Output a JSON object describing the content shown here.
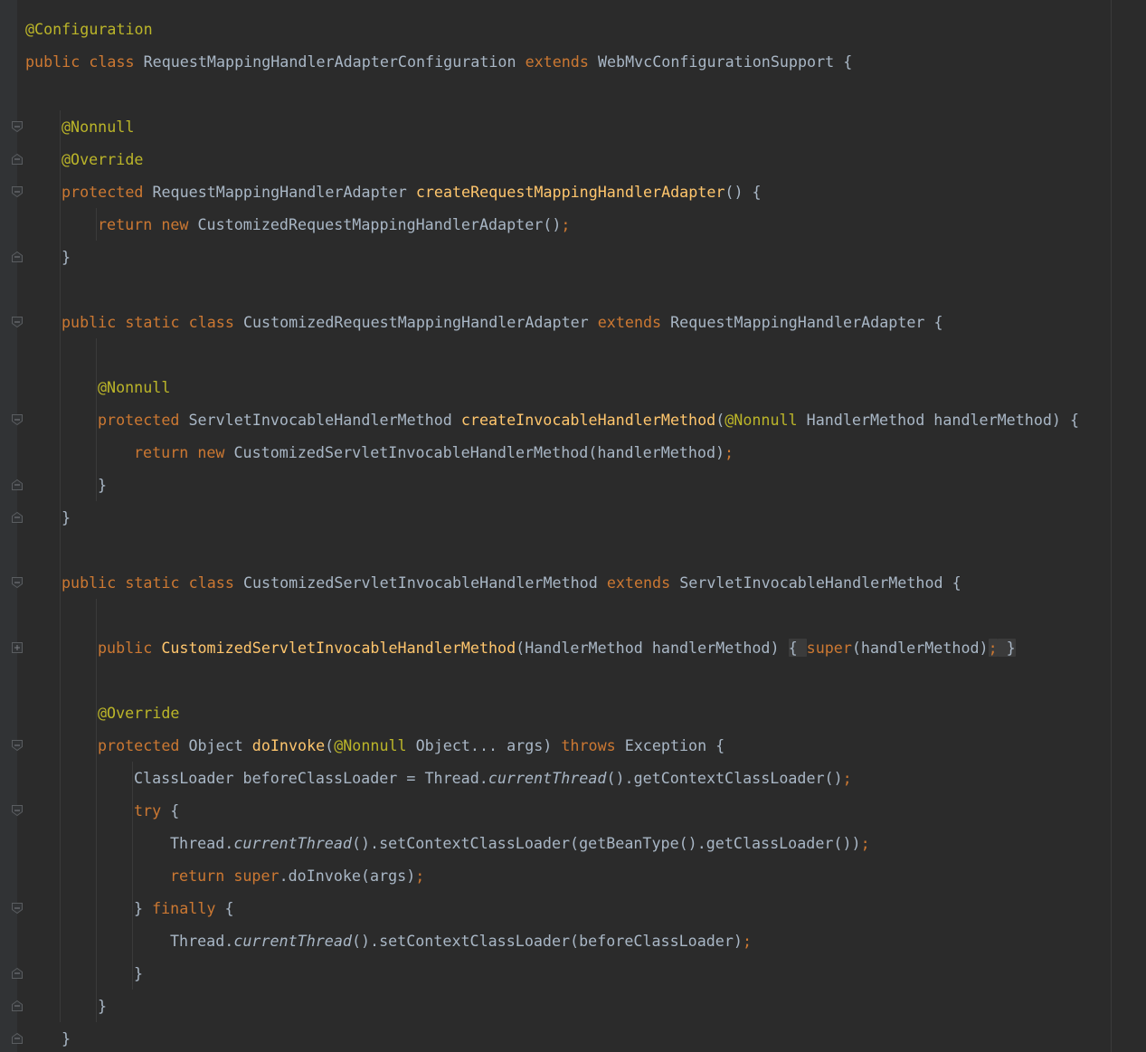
{
  "colors": {
    "background": "#2b2b2b",
    "keyword": "#cc7832",
    "annotation": "#bbb529",
    "method_declaration": "#ffc66d",
    "plain": "#a9b7c6"
  },
  "lines": [
    {
      "indent": 0,
      "fold": null,
      "tokens": [
        {
          "t": "@Configuration",
          "c": "a"
        }
      ]
    },
    {
      "indent": 0,
      "fold": null,
      "tokens": [
        {
          "t": "public class ",
          "c": "k"
        },
        {
          "t": "RequestMappingHandlerAdapterConfiguration ",
          "c": "p"
        },
        {
          "t": "extends ",
          "c": "k"
        },
        {
          "t": "WebMvcConfigurationSupport {",
          "c": "p"
        }
      ]
    },
    {
      "indent": 0,
      "fold": null,
      "tokens": []
    },
    {
      "indent": 1,
      "fold": "open",
      "tokens": [
        {
          "t": "@Nonnull",
          "c": "a"
        }
      ]
    },
    {
      "indent": 1,
      "fold": "end",
      "tokens": [
        {
          "t": "@Override",
          "c": "a"
        }
      ]
    },
    {
      "indent": 1,
      "fold": "open",
      "tokens": [
        {
          "t": "protected ",
          "c": "k"
        },
        {
          "t": "RequestMappingHandlerAdapter ",
          "c": "p"
        },
        {
          "t": "createRequestMappingHandlerAdapter",
          "c": "f"
        },
        {
          "t": "() {",
          "c": "p"
        }
      ]
    },
    {
      "indent": 2,
      "fold": null,
      "tokens": [
        {
          "t": "return new ",
          "c": "k"
        },
        {
          "t": "CustomizedRequestMappingHandlerAdapter()",
          "c": "p"
        },
        {
          "t": ";",
          "c": "k"
        }
      ]
    },
    {
      "indent": 1,
      "fold": "end",
      "tokens": [
        {
          "t": "}",
          "c": "p"
        }
      ]
    },
    {
      "indent": 0,
      "fold": null,
      "tokens": []
    },
    {
      "indent": 1,
      "fold": "open",
      "tokens": [
        {
          "t": "public static class ",
          "c": "k"
        },
        {
          "t": "CustomizedRequestMappingHandlerAdapter ",
          "c": "p"
        },
        {
          "t": "extends ",
          "c": "k"
        },
        {
          "t": "RequestMappingHandlerAdapter {",
          "c": "p"
        }
      ]
    },
    {
      "indent": 0,
      "fold": null,
      "tokens": []
    },
    {
      "indent": 2,
      "fold": null,
      "tokens": [
        {
          "t": "@Nonnull",
          "c": "a"
        }
      ]
    },
    {
      "indent": 2,
      "fold": "open",
      "tokens": [
        {
          "t": "protected ",
          "c": "k"
        },
        {
          "t": "ServletInvocableHandlerMethod ",
          "c": "p"
        },
        {
          "t": "createInvocableHandlerMethod",
          "c": "f"
        },
        {
          "t": "(",
          "c": "p"
        },
        {
          "t": "@Nonnull ",
          "c": "a"
        },
        {
          "t": "HandlerMethod handlerMethod) {",
          "c": "p"
        }
      ]
    },
    {
      "indent": 3,
      "fold": null,
      "tokens": [
        {
          "t": "return new ",
          "c": "k"
        },
        {
          "t": "CustomizedServletInvocableHandlerMethod(handlerMethod)",
          "c": "p"
        },
        {
          "t": ";",
          "c": "k"
        }
      ]
    },
    {
      "indent": 2,
      "fold": "end",
      "tokens": [
        {
          "t": "}",
          "c": "p"
        }
      ]
    },
    {
      "indent": 1,
      "fold": "end",
      "tokens": [
        {
          "t": "}",
          "c": "p"
        }
      ]
    },
    {
      "indent": 0,
      "fold": null,
      "tokens": []
    },
    {
      "indent": 1,
      "fold": "open",
      "tokens": [
        {
          "t": "public static class ",
          "c": "k"
        },
        {
          "t": "CustomizedServletInvocableHandlerMethod ",
          "c": "p"
        },
        {
          "t": "extends ",
          "c": "k"
        },
        {
          "t": "ServletInvocableHandlerMethod {",
          "c": "p"
        }
      ]
    },
    {
      "indent": 0,
      "fold": null,
      "tokens": []
    },
    {
      "indent": 2,
      "fold": "collapsed",
      "tokens": [
        {
          "t": "public ",
          "c": "k"
        },
        {
          "t": "CustomizedServletInvocableHandlerMethod",
          "c": "f"
        },
        {
          "t": "(HandlerMethod handlerMethod)",
          "c": "p"
        },
        {
          "t": " ",
          "c": "p"
        },
        {
          "t": "{ ",
          "c": "pb"
        },
        {
          "t": "super",
          "c": "k"
        },
        {
          "t": "(handlerMethod)",
          "c": "p"
        },
        {
          "t": ";",
          "c": "kb"
        },
        {
          "t": " }",
          "c": "pb"
        }
      ]
    },
    {
      "indent": 0,
      "fold": null,
      "tokens": []
    },
    {
      "indent": 2,
      "fold": null,
      "tokens": [
        {
          "t": "@Override",
          "c": "a"
        }
      ]
    },
    {
      "indent": 2,
      "fold": "open",
      "tokens": [
        {
          "t": "protected ",
          "c": "k"
        },
        {
          "t": "Object ",
          "c": "p"
        },
        {
          "t": "doInvoke",
          "c": "f"
        },
        {
          "t": "(",
          "c": "p"
        },
        {
          "t": "@Nonnull ",
          "c": "a"
        },
        {
          "t": "Object... args) ",
          "c": "p"
        },
        {
          "t": "throws ",
          "c": "k"
        },
        {
          "t": "Exception {",
          "c": "p"
        }
      ]
    },
    {
      "indent": 3,
      "fold": null,
      "tokens": [
        {
          "t": "ClassLoader beforeClassLoader = Thread.",
          "c": "p"
        },
        {
          "t": "currentThread",
          "c": "pi"
        },
        {
          "t": "().getContextClassLoader()",
          "c": "p"
        },
        {
          "t": ";",
          "c": "k"
        }
      ]
    },
    {
      "indent": 3,
      "fold": "open",
      "tokens": [
        {
          "t": "try ",
          "c": "k"
        },
        {
          "t": "{",
          "c": "p"
        }
      ]
    },
    {
      "indent": 4,
      "fold": null,
      "tokens": [
        {
          "t": "Thread.",
          "c": "p"
        },
        {
          "t": "currentThread",
          "c": "pi"
        },
        {
          "t": "().setContextClassLoader(getBeanType().getClassLoader())",
          "c": "p"
        },
        {
          "t": ";",
          "c": "k"
        }
      ]
    },
    {
      "indent": 4,
      "fold": null,
      "tokens": [
        {
          "t": "return super",
          "c": "k"
        },
        {
          "t": ".doInvoke(args)",
          "c": "p"
        },
        {
          "t": ";",
          "c": "k"
        }
      ]
    },
    {
      "indent": 3,
      "fold": "open",
      "tokens": [
        {
          "t": "} ",
          "c": "p"
        },
        {
          "t": "finally ",
          "c": "k"
        },
        {
          "t": "{",
          "c": "p"
        }
      ]
    },
    {
      "indent": 4,
      "fold": null,
      "tokens": [
        {
          "t": "Thread.",
          "c": "p"
        },
        {
          "t": "currentThread",
          "c": "pi"
        },
        {
          "t": "().setContextClassLoader(beforeClassLoader)",
          "c": "p"
        },
        {
          "t": ";",
          "c": "k"
        }
      ]
    },
    {
      "indent": 3,
      "fold": "end",
      "tokens": [
        {
          "t": "}",
          "c": "p"
        }
      ]
    },
    {
      "indent": 2,
      "fold": "end",
      "tokens": [
        {
          "t": "}",
          "c": "p"
        }
      ]
    },
    {
      "indent": 1,
      "fold": "end",
      "tokens": [
        {
          "t": "}",
          "c": "p"
        }
      ]
    }
  ]
}
